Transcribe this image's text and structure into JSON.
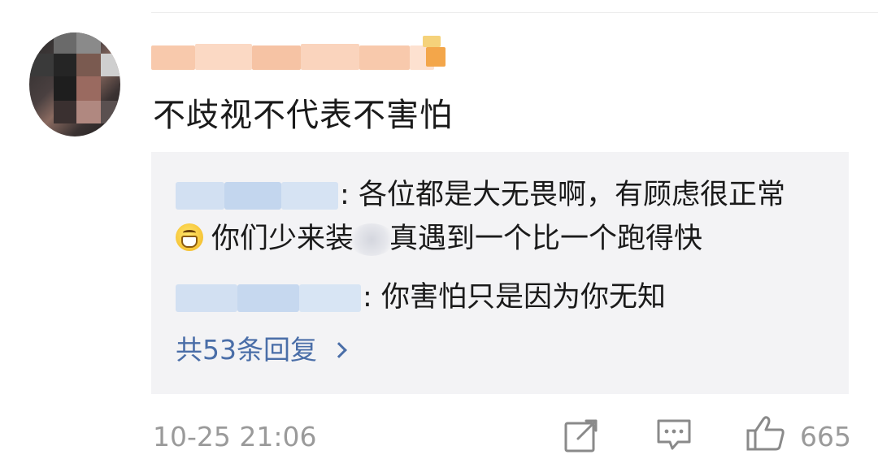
{
  "comment": {
    "text": "不歧视不代表不害怕",
    "timestamp": "10-25 21:06",
    "like_count": "665",
    "icons": {
      "share": "share-icon",
      "comment": "comment-icon",
      "like": "thumbs-up-icon"
    }
  },
  "replies": {
    "items": [
      {
        "text_before": "各位都是大无畏啊，有顾虑很正常",
        "emoji": "grin-icon",
        "text_after": "你们少来装",
        "text_tail": "真遇到一个比一个跑得快"
      },
      {
        "text": "你害怕只是因为你无知"
      }
    ],
    "more_label": "共53条回复"
  },
  "colors": {
    "link": "#4a6ea8",
    "meta": "#9a9a9a",
    "reply_bg": "#f3f3f5"
  }
}
